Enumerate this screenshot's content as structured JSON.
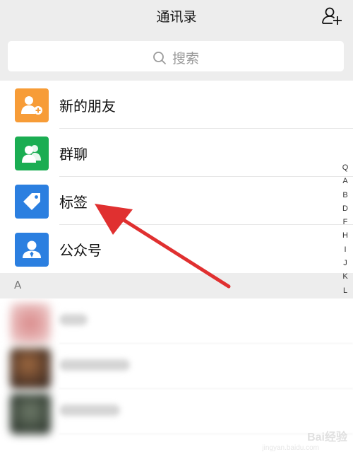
{
  "header": {
    "title": "通讯录"
  },
  "search": {
    "placeholder": "搜索"
  },
  "features": [
    {
      "label": "新的朋友",
      "icon": "new-friend-icon",
      "color": "#f79c37"
    },
    {
      "label": "群聊",
      "icon": "group-chat-icon",
      "color": "#1aad52"
    },
    {
      "label": "标签",
      "icon": "tag-icon",
      "color": "#2b7fe0"
    },
    {
      "label": "公众号",
      "icon": "official-account-icon",
      "color": "#2b7fe0"
    }
  ],
  "section_header": "A",
  "alphabet_index": [
    "Q",
    "A",
    "B",
    "D",
    "F",
    "H",
    "I",
    "J",
    "K",
    "L"
  ],
  "watermark": {
    "brand": "Bai经验",
    "url": "jingyan.baidu.com"
  },
  "colors": {
    "nav_bg": "#ededed",
    "arrow": "#e03030"
  }
}
